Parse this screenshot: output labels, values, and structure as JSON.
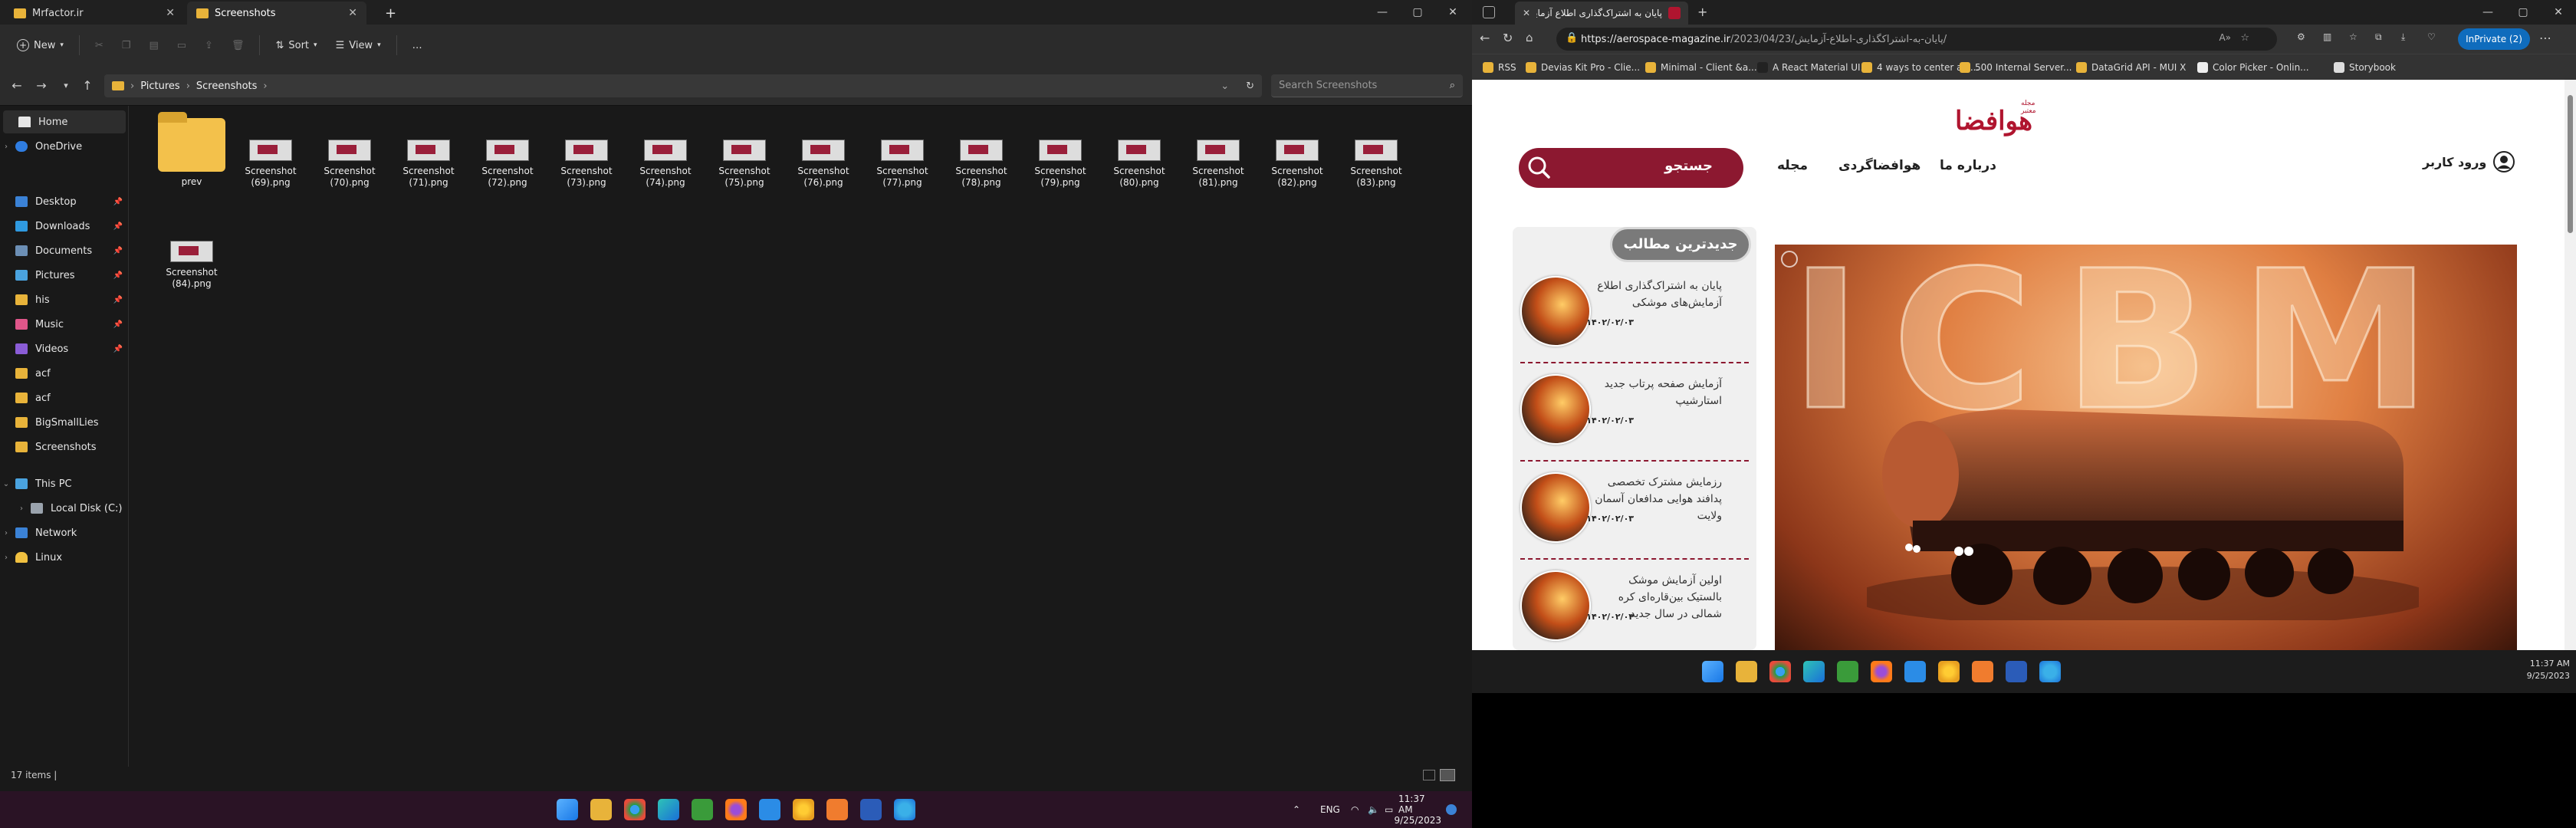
{
  "explorer": {
    "tabs": [
      {
        "label": "Mrfactor.ir"
      },
      {
        "label": "Screenshots"
      }
    ],
    "new_tab_symbol": "+",
    "ribbon": {
      "new_label": "New",
      "sort_label": "Sort",
      "view_label": "View",
      "more_label": "…"
    },
    "breadcrumb": [
      "Pictures",
      "Screenshots"
    ],
    "search_placeholder": "Search Screenshots",
    "nav": {
      "home": "Home",
      "onedrive": "OneDrive",
      "quick": [
        {
          "label": "Desktop",
          "color": "#3b82d6"
        },
        {
          "label": "Downloads",
          "color": "#2f9ae0"
        },
        {
          "label": "Documents",
          "color": "#6c8fb5"
        },
        {
          "label": "Pictures",
          "color": "#4aa3df"
        },
        {
          "label": "his",
          "color": "#e8b33a"
        },
        {
          "label": "Music",
          "color": "#e0568a"
        },
        {
          "label": "Videos",
          "color": "#8a5cd6"
        },
        {
          "label": "acf",
          "color": "#e8b33a"
        },
        {
          "label": "acf",
          "color": "#e8b33a"
        },
        {
          "label": "BigSmallLies",
          "color": "#e8b33a"
        },
        {
          "label": "Screenshots",
          "color": "#e8b33a"
        }
      ],
      "this_pc": "This PC",
      "local_disk": "Local Disk (C:)",
      "network": "Network",
      "linux": "Linux"
    },
    "files": [
      {
        "name": "prev"
      },
      {
        "name": "Screenshot (69).png"
      },
      {
        "name": "Screenshot (70).png"
      },
      {
        "name": "Screenshot (71).png"
      },
      {
        "name": "Screenshot (72).png"
      },
      {
        "name": "Screenshot (73).png"
      },
      {
        "name": "Screenshot (74).png"
      },
      {
        "name": "Screenshot (75).png"
      },
      {
        "name": "Screenshot (76).png"
      },
      {
        "name": "Screenshot (77).png"
      },
      {
        "name": "Screenshot (78).png"
      },
      {
        "name": "Screenshot (79).png"
      },
      {
        "name": "Screenshot (80).png"
      },
      {
        "name": "Screenshot (81).png"
      },
      {
        "name": "Screenshot (82).png"
      },
      {
        "name": "Screenshot (83).png"
      },
      {
        "name": "Screenshot (84).png"
      }
    ],
    "status": "17 items  |",
    "tray": {
      "lang": "ENG",
      "time": "11:37 AM",
      "date": "9/25/2023"
    }
  },
  "browser": {
    "tab_title": "پایان به اشتراک‌گذاری اطلاع آزمایش...",
    "url_host": "https://aerospace-magazine.ir",
    "url_path": "/2023/04/23/پایان-به-اشتراکگذاری-اطلاع-آزمایش/",
    "inprivate": "InPrivate (2)",
    "bookmarks": [
      {
        "label": "RSS",
        "color": "#e8b33a"
      },
      {
        "label": "Devias Kit Pro - Clie...",
        "color": "#e8b33a"
      },
      {
        "label": "Minimal - Client &a...",
        "color": "#e8b33a"
      },
      {
        "label": "A React Material UI...",
        "color": "#222222"
      },
      {
        "label": "4 ways to center a c...",
        "color": "#e8b33a"
      },
      {
        "label": "500 Internal Server...",
        "color": "#e8b33a"
      },
      {
        "label": "DataGrid API - MUI X",
        "color": "#e8b33a"
      },
      {
        "label": "Color Picker - Onlin...",
        "color": "#eeeeee"
      },
      {
        "label": "Storybook",
        "color": "#dddddd"
      }
    ],
    "site": {
      "logo_text": "هوافضا",
      "logo_small": "مجله معتبر",
      "search_label": "جستجو",
      "nav": [
        "مجله",
        "هوافضاگردی",
        "درباره ما"
      ],
      "login": "ورود کاربر",
      "latest_title": "جدیدترین مطالب",
      "articles": [
        {
          "title": "پایان به اشتراک‌گذاری اطلاع آزمایش‌های موشکی",
          "date": "۱۴۰۲/۰۲/۰۳"
        },
        {
          "title": "آزمایش صفحه پرتاب جدید استارشیپ",
          "date": "۱۴۰۲/۰۲/۰۳"
        },
        {
          "title": "رزمایش مشترک تخصصی پدافند هوایی مدافعان آسمان ولایت",
          "date": "۱۴۰۲/۰۲/۰۳"
        },
        {
          "title": "اولین آزمایش موشک بالستیک بین‌قاره‌ای کره شمالی در سال جدید",
          "date": "۱۴۰۲/۰۲/۰۳"
        }
      ],
      "hero_word": "ICBM"
    },
    "tray": {
      "time": "11:37 AM",
      "date": "9/25/2023"
    }
  }
}
